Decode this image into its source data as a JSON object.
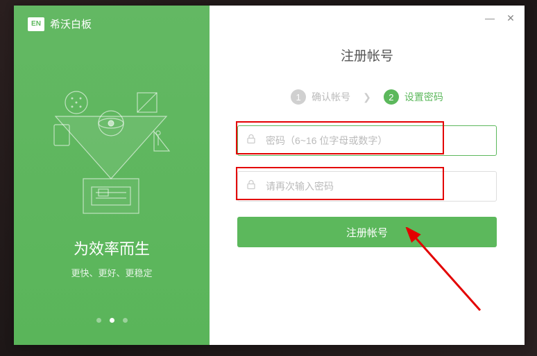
{
  "logo": {
    "badge": "EN",
    "text": "希沃白板"
  },
  "left": {
    "tagline_title": "为效率而生",
    "tagline_sub": "更快、更好、更稳定"
  },
  "form": {
    "title": "注册帐号",
    "steps": {
      "s1_num": "1",
      "s1_label": "确认帐号",
      "s2_num": "2",
      "s2_label": "设置密码"
    },
    "password_placeholder": "密码（6~16 位字母或数字）",
    "confirm_placeholder": "请再次输入密码",
    "submit_label": "注册帐号"
  }
}
